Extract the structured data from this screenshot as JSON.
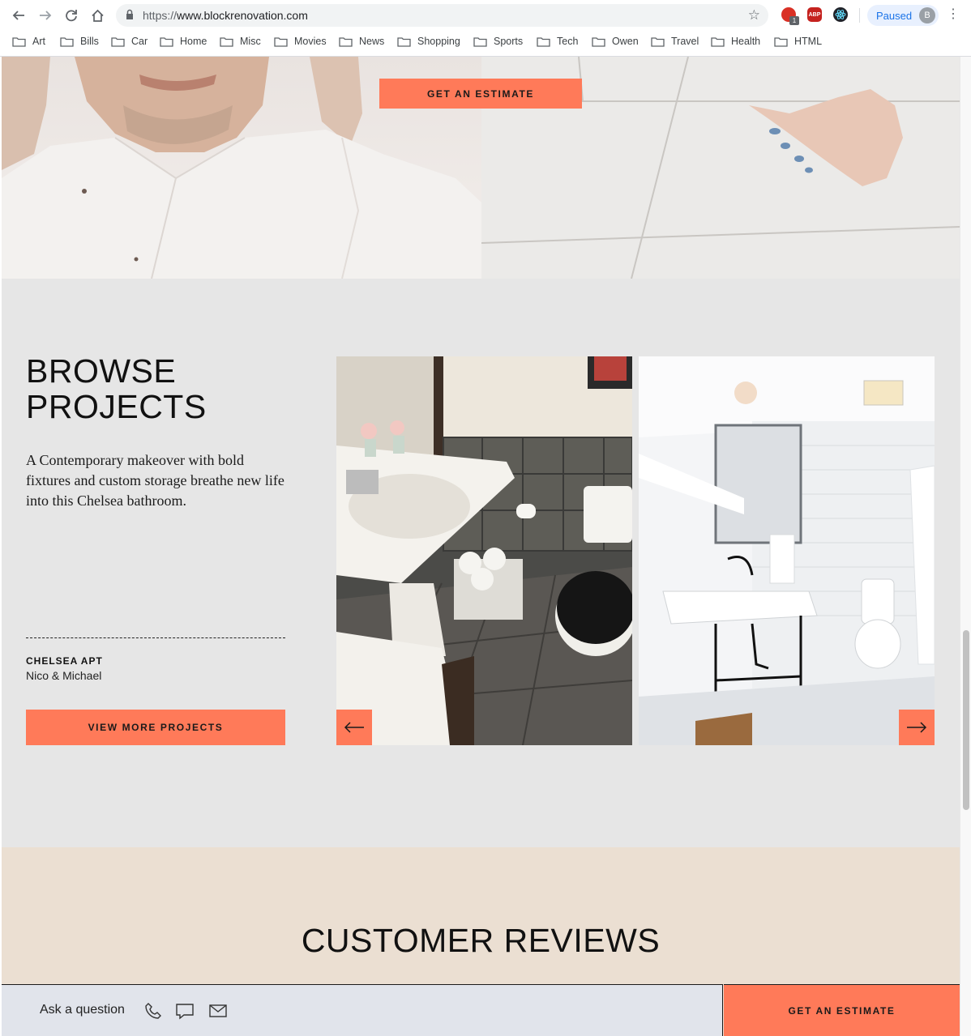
{
  "browser": {
    "url_prefix": "https://",
    "url_host": "www.blockrenovation.com",
    "profile_status": "Paused",
    "profile_initial": "B",
    "extension_badge": "1",
    "abp_label": "ABP"
  },
  "bookmarks": [
    "Art",
    "Bills",
    "Car",
    "Home",
    "Misc",
    "Movies",
    "News",
    "Shopping",
    "Sports",
    "Tech",
    "Owen",
    "Travel",
    "Health",
    "HTML"
  ],
  "hero": {
    "cta_label": "GET AN ESTIMATE"
  },
  "browse": {
    "title_line1": "BROWSE",
    "title_line2": "PROJECTS",
    "description": "A Contemporary makeover with bold fixtures and custom storage breathe new life into this Chelsea bathroom.",
    "project_name": "CHELSEA APT",
    "project_owner": "Nico & Michael",
    "view_more_label": "VIEW MORE PROJECTS"
  },
  "reviews": {
    "title": "CUSTOMER REVIEWS"
  },
  "sticky_bar": {
    "ask_label": "Ask a question",
    "cta_label": "GET AN ESTIMATE"
  },
  "colors": {
    "accent": "#ff7a59",
    "browse_bg": "#e6e6e6",
    "reviews_bg": "#ebdfd2",
    "ask_bar_bg": "#e1e4eb"
  }
}
